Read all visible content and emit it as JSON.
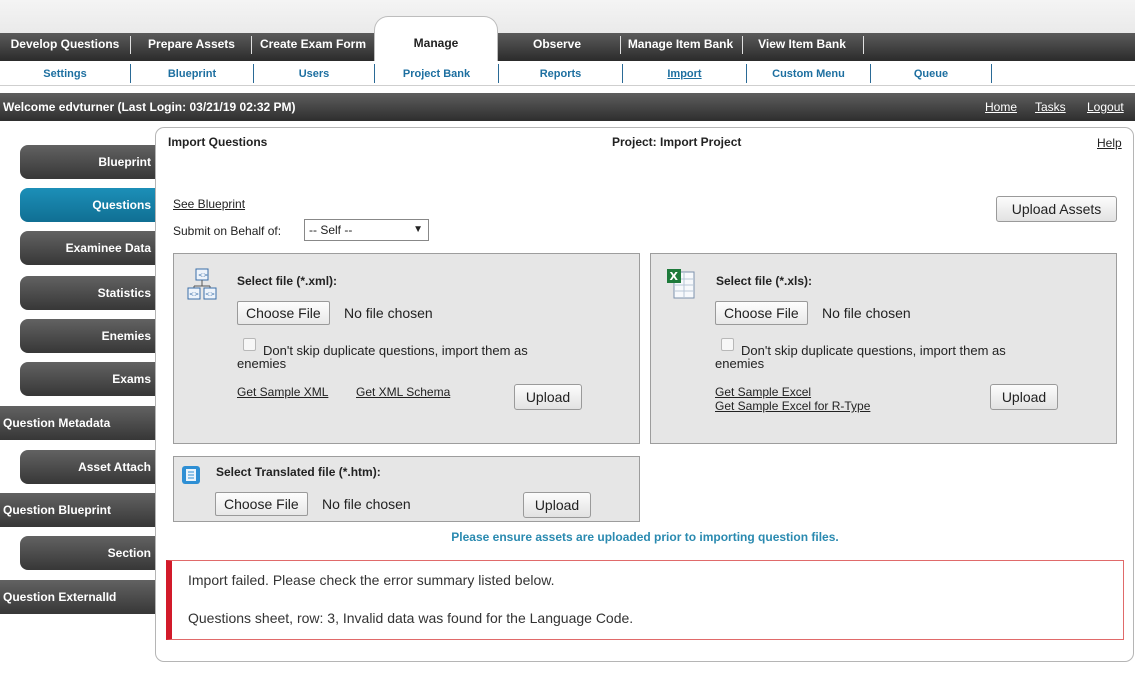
{
  "main_nav": {
    "tabs": [
      "Develop Questions",
      "Prepare Assets",
      "Create Exam Form",
      "Manage",
      "Observe",
      "Manage Item Bank",
      "View Item Bank"
    ],
    "active": "Manage"
  },
  "sub_nav": {
    "items": [
      "Settings",
      "Blueprint",
      "Users",
      "Project Bank",
      "Reports",
      "Import",
      "Custom Menu",
      "Queue"
    ],
    "selected": "Import"
  },
  "welcome": {
    "text": "Welcome edvturner (Last Login: 03/21/19   02:32 PM)",
    "links": [
      "Home",
      "Tasks",
      "Logout"
    ]
  },
  "sidebar": {
    "items": [
      "Blueprint",
      "Questions",
      "Examinee Data",
      "Statistics",
      "Enemies",
      "Exams",
      "Question Metadata",
      "Asset Attach",
      "Question Blueprint",
      "Section",
      "Question ExternalId"
    ],
    "active": "Questions"
  },
  "panel": {
    "title": "Import Questions",
    "project": "Project: Import Project",
    "help": "Help",
    "see_blueprint": "See Blueprint",
    "behalf_label": "Submit on Behalf of:",
    "behalf_value": "-- Self --",
    "upload_assets": "Upload Assets"
  },
  "xml": {
    "label": "Select file (*.xml):",
    "choose": "Choose File",
    "no_file": "No file chosen",
    "dup_line1": "Don't skip duplicate questions, import them as",
    "dup_line2": "enemies",
    "link1": "Get Sample XML",
    "link2": "Get XML Schema",
    "upload": "Upload"
  },
  "xls": {
    "label": "Select file (*.xls):",
    "choose": "Choose File",
    "no_file": "No file chosen",
    "dup_line1": "Don't skip duplicate questions, import them as",
    "dup_line2": "enemies",
    "link1": "Get Sample Excel",
    "link2": "Get Sample Excel for R-Type",
    "upload": "Upload"
  },
  "htm": {
    "label": "Select Translated file (*.htm):",
    "choose": "Choose File",
    "no_file": "No file chosen",
    "upload": "Upload"
  },
  "notice": "Please ensure assets are uploaded prior to importing question files.",
  "error": {
    "line1": "Import failed. Please check the error summary listed below.",
    "line2": "Questions sheet, row: 3, Invalid data was found for the Language Code."
  },
  "colors": {
    "accent": "#1c8fb8",
    "nav_dark": "#2b2b2b",
    "sub_nav_link": "#1d6fa0",
    "error_border": "#d21a2a",
    "notice": "#2a8ab0"
  }
}
